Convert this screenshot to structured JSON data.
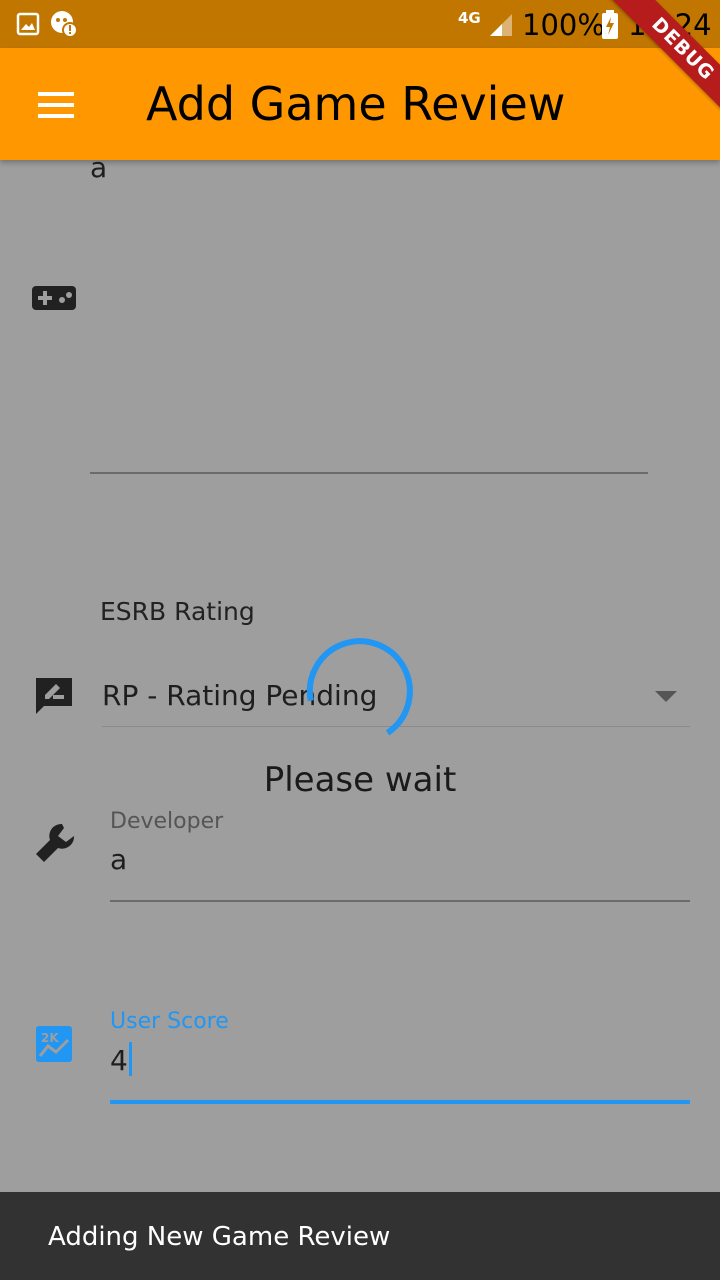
{
  "status_bar": {
    "network": "4G",
    "battery": "100%",
    "time": "19:24"
  },
  "debug_banner": "DEBUG",
  "app_bar": {
    "title": "Add Game Review"
  },
  "form": {
    "description_value": "a",
    "esrb": {
      "label": "ESRB Rating",
      "value": "RP - Rating Pending"
    },
    "developer": {
      "label": "Developer",
      "value": "a"
    },
    "user_score": {
      "label": "User Score",
      "value": "4"
    }
  },
  "loading": {
    "message": "Please wait"
  },
  "snackbar": {
    "message": "Adding New Game Review"
  },
  "colors": {
    "primary": "#ff9800",
    "status_bar": "#c17600",
    "accent": "#2196f3",
    "scrim": "#9e9e9e",
    "snackbar": "#323232",
    "debug": "#b71c1c"
  }
}
